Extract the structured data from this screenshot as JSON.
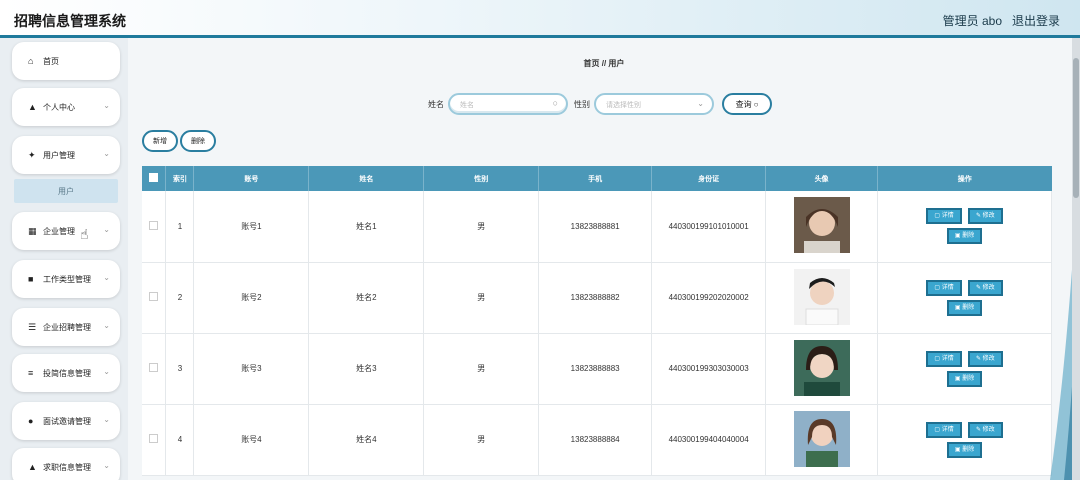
{
  "header": {
    "title": "招聘信息管理系统",
    "admin": "管理员 abo",
    "logout": "退出登录"
  },
  "sidebar": {
    "items": [
      {
        "label": "首页",
        "icon": "home-icon",
        "glyph": "⌂"
      },
      {
        "label": "个人中心",
        "icon": "person-icon",
        "glyph": "▲"
      },
      {
        "label": "用户管理",
        "icon": "pin-icon",
        "glyph": "✦"
      },
      {
        "label": "企业管理",
        "icon": "grid-icon",
        "glyph": "▦"
      },
      {
        "label": "工作类型管理",
        "icon": "briefcase-icon",
        "glyph": "■"
      },
      {
        "label": "企业招聘管理",
        "icon": "sliders-icon",
        "glyph": "☰"
      },
      {
        "label": "投简信息管理",
        "icon": "list-icon",
        "glyph": "≡"
      },
      {
        "label": "面试邀请管理",
        "icon": "location-icon",
        "glyph": "●"
      },
      {
        "label": "求职信息管理",
        "icon": "person-icon",
        "glyph": "▲"
      }
    ],
    "sub_item": "用户"
  },
  "main": {
    "breadcrumb": "首页 // 用户",
    "search": {
      "name_label": "姓名",
      "name_placeholder": "姓名",
      "gender_label": "性别",
      "gender_placeholder": "请选择性别",
      "query_label": "查询"
    },
    "actions": {
      "add": "新增",
      "delete": "删除"
    },
    "table": {
      "headers": [
        "索引",
        "账号",
        "姓名",
        "性别",
        "手机",
        "身份证",
        "头像",
        "操作"
      ],
      "rows": [
        {
          "index": "1",
          "account": "账号1",
          "name": "姓名1",
          "gender": "男",
          "phone": "13823888881",
          "idcard": "440300199101010001"
        },
        {
          "index": "2",
          "account": "账号2",
          "name": "姓名2",
          "gender": "男",
          "phone": "13823888882",
          "idcard": "440300199202020002"
        },
        {
          "index": "3",
          "account": "账号3",
          "name": "姓名3",
          "gender": "男",
          "phone": "13823888883",
          "idcard": "440300199303030003"
        },
        {
          "index": "4",
          "account": "账号4",
          "name": "姓名4",
          "gender": "男",
          "phone": "13823888884",
          "idcard": "440300199404040004"
        }
      ],
      "op_detail": "详情",
      "op_edit": "修改",
      "op_delete": "删除"
    }
  },
  "colors": {
    "accent": "#1f7a9c",
    "table_header": "#4b98b8",
    "op_button": "#3aa6cf"
  }
}
